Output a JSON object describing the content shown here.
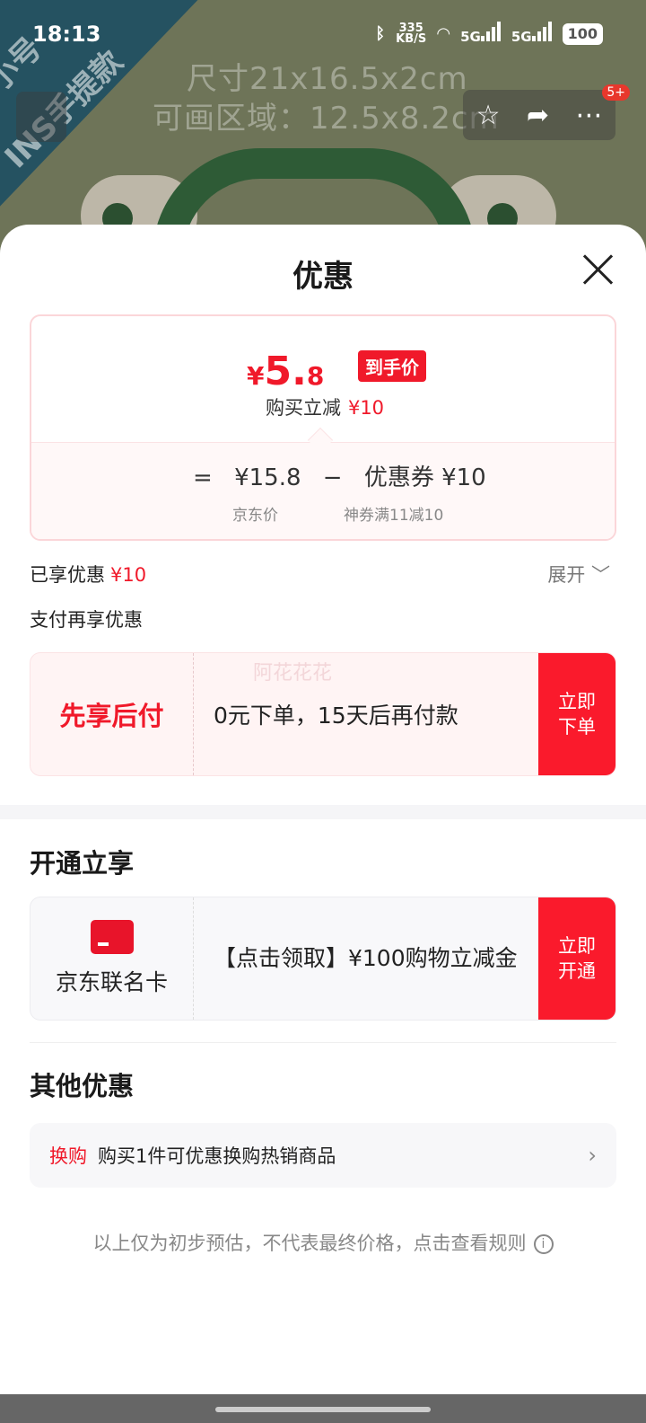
{
  "status_bar": {
    "time": "18:13",
    "speed_value": "335",
    "speed_unit": "KB/S",
    "net1": "5G",
    "net2": "5G",
    "battery": "100"
  },
  "backdrop": {
    "watermark_line1": "小号",
    "watermark_line2": "INS手提款",
    "dim_line1": "尺寸21x16.5x2cm",
    "dim_line2": "可画区域：12.5x8.2cm",
    "badge": "5+"
  },
  "sheet": {
    "title": "优惠",
    "price_card": {
      "currency": "¥",
      "price_int": "5.",
      "price_dec": "8",
      "hand_tag": "到手价",
      "reduce_label": "购买立减",
      "reduce_value": "¥10",
      "formula_eq": "=",
      "jd_price": "¥15.8",
      "formula_minus": "−",
      "coupon": "优惠券 ¥10",
      "jd_price_label": "京东价",
      "coupon_label": "神券满11减10"
    },
    "enjoyed_label": "已享优惠",
    "enjoyed_value": "¥10",
    "expand_label": "展开 ﹀",
    "pay_again": "支付再享优惠",
    "pay_later": {
      "title": "先享后付",
      "ghost": "阿花花花",
      "desc": "0元下单，15天后再付款",
      "button": "立即下单"
    },
    "open_section_title": "开通立享",
    "cobrand": {
      "title": "京东联名卡",
      "desc": "【点击领取】¥100购物立减金",
      "button": "立即开通"
    },
    "other_section_title": "其他优惠",
    "swap": {
      "tag": "换购",
      "desc": "购买1件可优惠换购热销商品",
      "arrow": "›"
    },
    "footnote": "以上仅为初步预估，不代表最终价格，点击查看规则",
    "info_icon": "i"
  },
  "colors": {
    "accent": "#f0192a",
    "button": "#fa1a2c"
  }
}
